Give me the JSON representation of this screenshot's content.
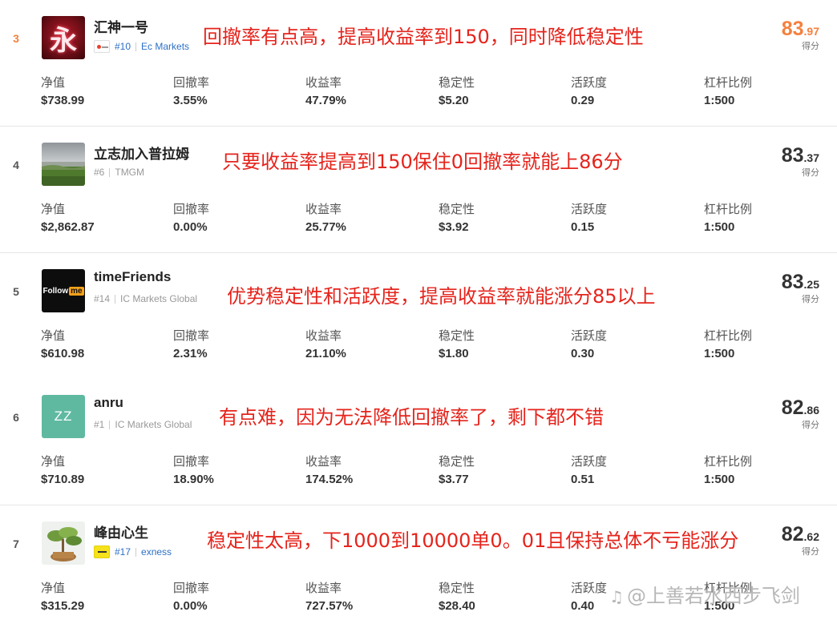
{
  "stat_labels": {
    "net_value": "净值",
    "drawdown": "回撤率",
    "return_rate": "收益率",
    "stability": "稳定性",
    "activity": "活跃度",
    "leverage": "杠杆比例"
  },
  "score_label": "得分",
  "rows": [
    {
      "rank": "3",
      "name": "汇神一号",
      "avatar_text": "永",
      "broker_rank": "#10",
      "broker": "Ec Markets",
      "note": "回撤率有点高，提高收益率到150，同时降低稳定性",
      "score_int": "83",
      "score_dec": ".97",
      "net_value": "$738.99",
      "drawdown": "3.55%",
      "return_rate": "47.79%",
      "stability": "$5.20",
      "activity": "0.29",
      "leverage": "1:500"
    },
    {
      "rank": "4",
      "name": "立志加入普拉姆",
      "broker_rank": "#6",
      "broker": "TMGM",
      "note": "只要收益率提高到150保住0回撤率就能上86分",
      "score_int": "83",
      "score_dec": ".37",
      "net_value": "$2,862.87",
      "drawdown": "0.00%",
      "return_rate": "25.77%",
      "stability": "$3.92",
      "activity": "0.15",
      "leverage": "1:500"
    },
    {
      "rank": "5",
      "name": "timeFriends",
      "avatar_text": "Follow",
      "avatar_text2": "me",
      "broker_rank": "#14",
      "broker": "IC Markets Global",
      "note": "优势稳定性和活跃度，提高收益率就能涨分85以上",
      "score_int": "83",
      "score_dec": ".25",
      "net_value": "$610.98",
      "drawdown": "2.31%",
      "return_rate": "21.10%",
      "stability": "$1.80",
      "activity": "0.30",
      "leverage": "1:500"
    },
    {
      "rank": "6",
      "name": "anru",
      "avatar_text": "ZZ",
      "broker_rank": "#1",
      "broker": "IC Markets Global",
      "note": "有点难，因为无法降低回撤率了，剩下都不错",
      "score_int": "82",
      "score_dec": ".86",
      "net_value": "$710.89",
      "drawdown": "18.90%",
      "return_rate": "174.52%",
      "stability": "$3.77",
      "activity": "0.51",
      "leverage": "1:500"
    },
    {
      "rank": "7",
      "name": "峰由心生",
      "broker_rank": "#17",
      "broker": "exness",
      "note": "稳定性太高，下1000到10000单0。01且保持总体不亏能涨分",
      "score_int": "82",
      "score_dec": ".62",
      "net_value": "$315.29",
      "drawdown": "0.00%",
      "return_rate": "727.57%",
      "stability": "$28.40",
      "activity": "0.40",
      "leverage": "1:500"
    }
  ],
  "watermark": "@上善若水西步飞剑",
  "colors": {
    "accent_orange": "#f5803e",
    "note_red": "#e5241c",
    "link_blue": "#2c6fc7"
  }
}
